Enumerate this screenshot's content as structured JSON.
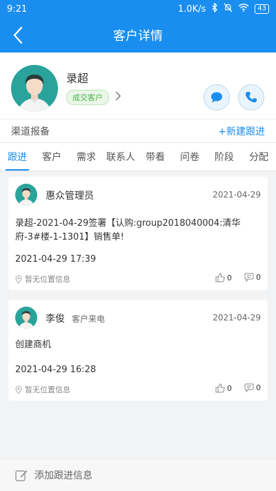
{
  "status": {
    "time": "9:21",
    "speed": "1.0K/s",
    "battery": "43"
  },
  "header": {
    "title": "客户详情"
  },
  "profile": {
    "name": "录超",
    "tag": "成交客户"
  },
  "channel": {
    "label": "渠道报备",
    "new_followup": "+新建跟进"
  },
  "tabs": [
    "跟进",
    "客户",
    "需求",
    "联系人",
    "带看",
    "问卷",
    "阶段",
    "分配"
  ],
  "records": [
    {
      "author": "惠众管理员",
      "sub": "",
      "date": "2021-04-29",
      "content": "录超-2021-04-29签署【认购:group2018040004:清华府-3#楼-1-1301】销售单!",
      "time": "2021-04-29 17:39",
      "location": "暂无位置信息",
      "likes": "0",
      "comments": "0"
    },
    {
      "author": "李俊",
      "sub": "客户来电",
      "date": "2021-04-29",
      "content": "创建商机",
      "time": "2021-04-29 16:28",
      "location": "暂无位置信息",
      "likes": "0",
      "comments": "0"
    }
  ],
  "bottom": {
    "placeholder": "添加跟进信息"
  }
}
